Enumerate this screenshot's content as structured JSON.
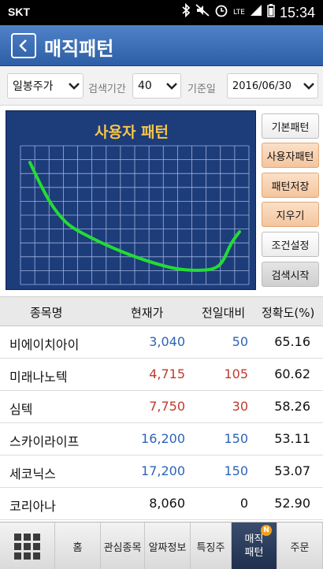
{
  "status": {
    "carrier": "SKT",
    "time": "15:34",
    "network": "LTE"
  },
  "header": {
    "title": "매직패턴"
  },
  "filters": {
    "price_type": "일봉주가",
    "period_label": "검색기간",
    "period_value": "40",
    "date_label": "기준일",
    "date_value": "2016/06/30"
  },
  "chart": {
    "title": "사용자 패턴",
    "line_color": "#22dd33",
    "grid_color": "#9fb3de",
    "background": "#1d3c7a"
  },
  "chart_data": {
    "type": "line",
    "title": "사용자 패턴",
    "xlabel": "",
    "ylabel": "",
    "grid": true,
    "note": "values read relative to plot area (0=bottom, 100=top), x as fraction of width",
    "x": [
      0,
      0.05,
      0.1,
      0.15,
      0.2,
      0.3,
      0.4,
      0.5,
      0.6,
      0.7,
      0.8,
      0.88,
      0.92,
      0.96,
      1.0
    ],
    "values": [
      88,
      72,
      58,
      48,
      41,
      33,
      26,
      20,
      15,
      11,
      10,
      11,
      16,
      30,
      38
    ]
  },
  "side_buttons": [
    {
      "label": "기본패턴",
      "style": "white"
    },
    {
      "label": "사용자패턴",
      "style": "orange"
    },
    {
      "label": "패턴저장",
      "style": "orange"
    },
    {
      "label": "지우기",
      "style": "orange"
    },
    {
      "label": "조건설정",
      "style": "white"
    },
    {
      "label": "검색시작",
      "style": "gray"
    }
  ],
  "table": {
    "headers": [
      "종목명",
      "현재가",
      "전일대비",
      "정확도(%)"
    ],
    "rows": [
      {
        "name": "비에이치아이",
        "price": "3,040",
        "change": "50",
        "accuracy": "65.16",
        "dir": "down"
      },
      {
        "name": "미래나노텍",
        "price": "4,715",
        "change": "105",
        "accuracy": "60.62",
        "dir": "up"
      },
      {
        "name": "심텍",
        "price": "7,750",
        "change": "30",
        "accuracy": "58.26",
        "dir": "up"
      },
      {
        "name": "스카이라이프",
        "price": "16,200",
        "change": "150",
        "accuracy": "53.11",
        "dir": "down"
      },
      {
        "name": "세코닉스",
        "price": "17,200",
        "change": "150",
        "accuracy": "53.07",
        "dir": "down"
      },
      {
        "name": "코리아나",
        "price": "8,060",
        "change": "0",
        "accuracy": "52.90",
        "dir": "flat"
      }
    ]
  },
  "colors": {
    "up": "#c0392b",
    "down": "#2c64b8",
    "flat": "#111111",
    "accent": "#3a69b0"
  },
  "bottom_nav": {
    "items": [
      "홈",
      "관심종목",
      "알짜정보",
      "특징주",
      "매직패턴",
      "주문"
    ],
    "active": "매직패턴",
    "badge": "N"
  }
}
